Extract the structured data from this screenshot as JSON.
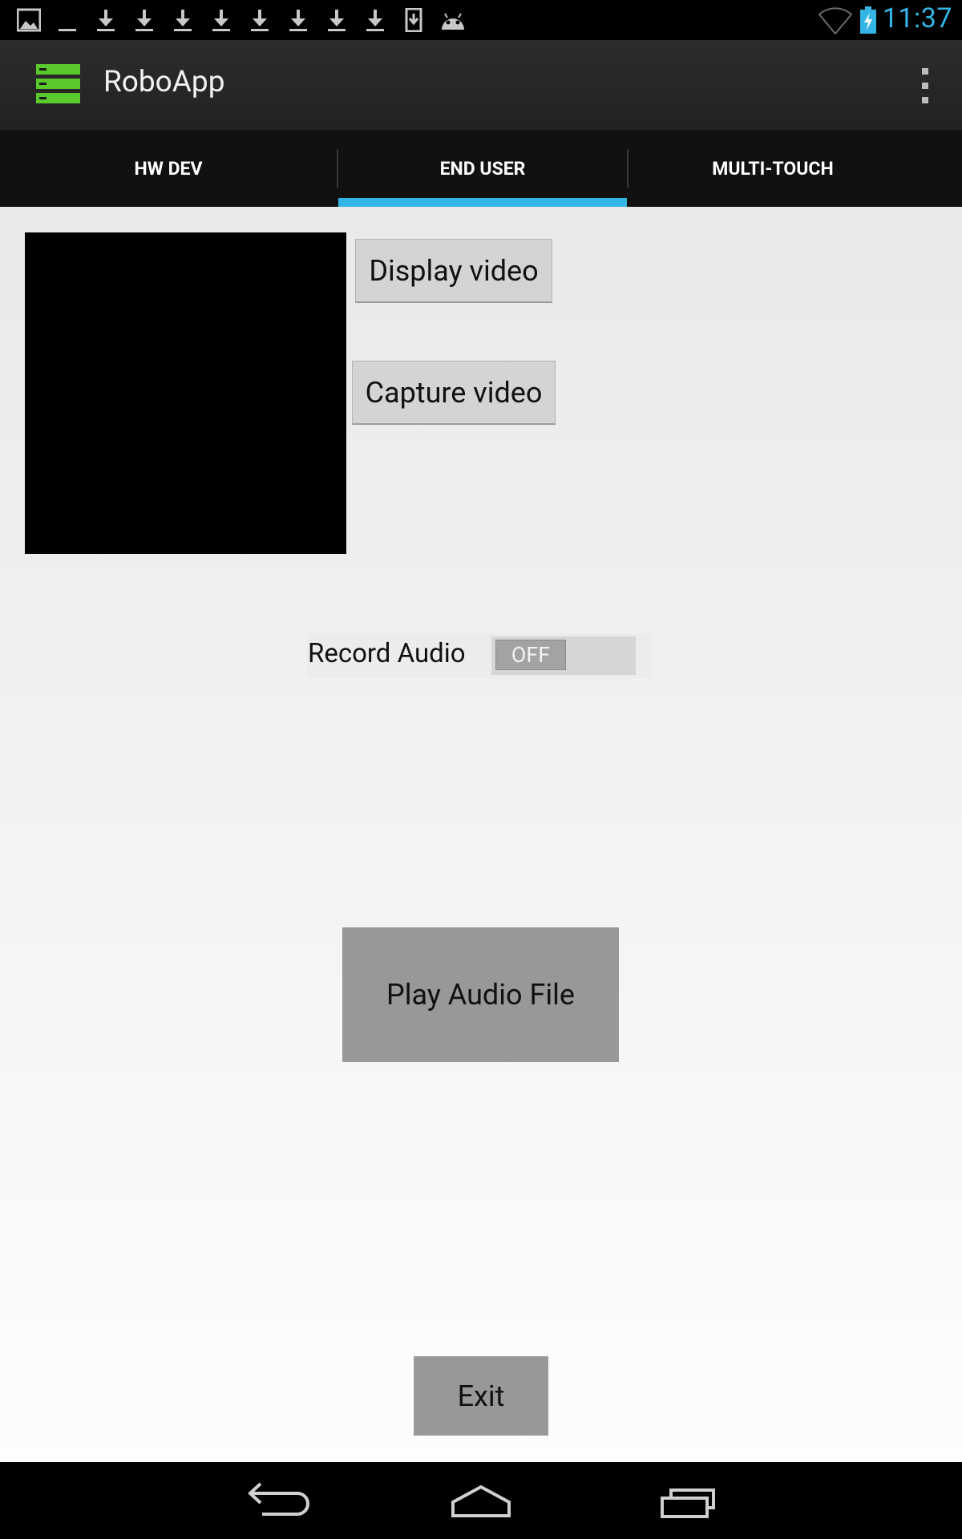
{
  "status_bar": {
    "time": "11:37",
    "notification_icons": [
      "image-notification-icon",
      "download-icon",
      "download-icon",
      "download-icon",
      "download-icon",
      "download-icon",
      "download-icon",
      "download-icon",
      "download-icon",
      "download-icon",
      "device-download-icon",
      "android-debug-icon"
    ],
    "status_icons": [
      "wifi-icon",
      "battery-charging-icon"
    ],
    "accent_color": "#33b5e5"
  },
  "action_bar": {
    "title": "RoboApp",
    "logo_icon": "server-stack-icon",
    "overflow_icon": "overflow-menu-icon"
  },
  "tabs": [
    {
      "label": "HW DEV",
      "active": false
    },
    {
      "label": "END USER",
      "active": true
    },
    {
      "label": "MULTI-TOUCH",
      "active": false
    }
  ],
  "main": {
    "display_video_label": "Display video",
    "capture_video_label": "Capture video",
    "record_audio_label": "Record Audio",
    "record_audio_state": "OFF",
    "play_audio_label": "Play Audio File",
    "exit_label": "Exit"
  },
  "nav_bar": {
    "icons": [
      "back-icon",
      "home-icon",
      "recent-apps-icon"
    ]
  }
}
